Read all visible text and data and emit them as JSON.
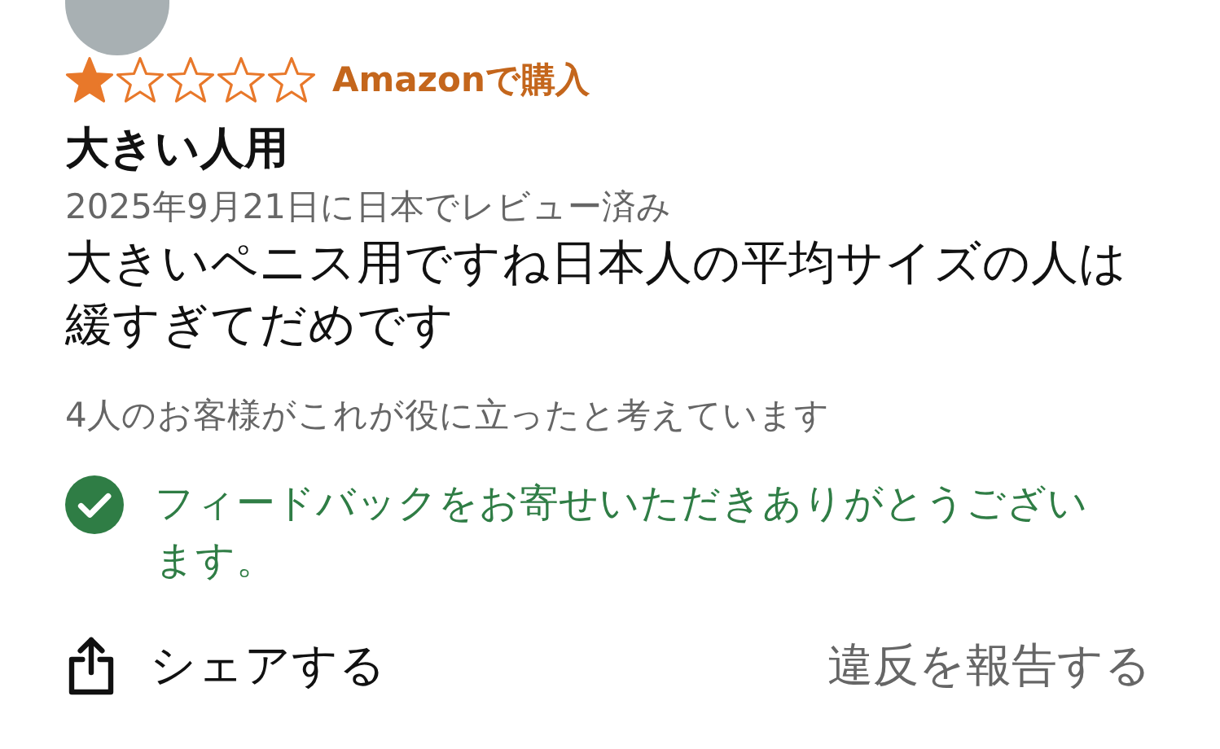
{
  "review": {
    "stars": 1,
    "badge": "Amazonで購入",
    "title": "大きい人用",
    "date": "2025年9月21日に日本でレビュー済み",
    "body": "大きいペニス用ですね日本人の平均サイズの人は緩すぎてだめです",
    "helpful": "4人のお客様がこれが役に立ったと考えています",
    "feedback": "フィードバックをお寄せいただきありがとうございます。"
  },
  "actions": {
    "share": "シェアする",
    "report": "違反を報告する"
  }
}
